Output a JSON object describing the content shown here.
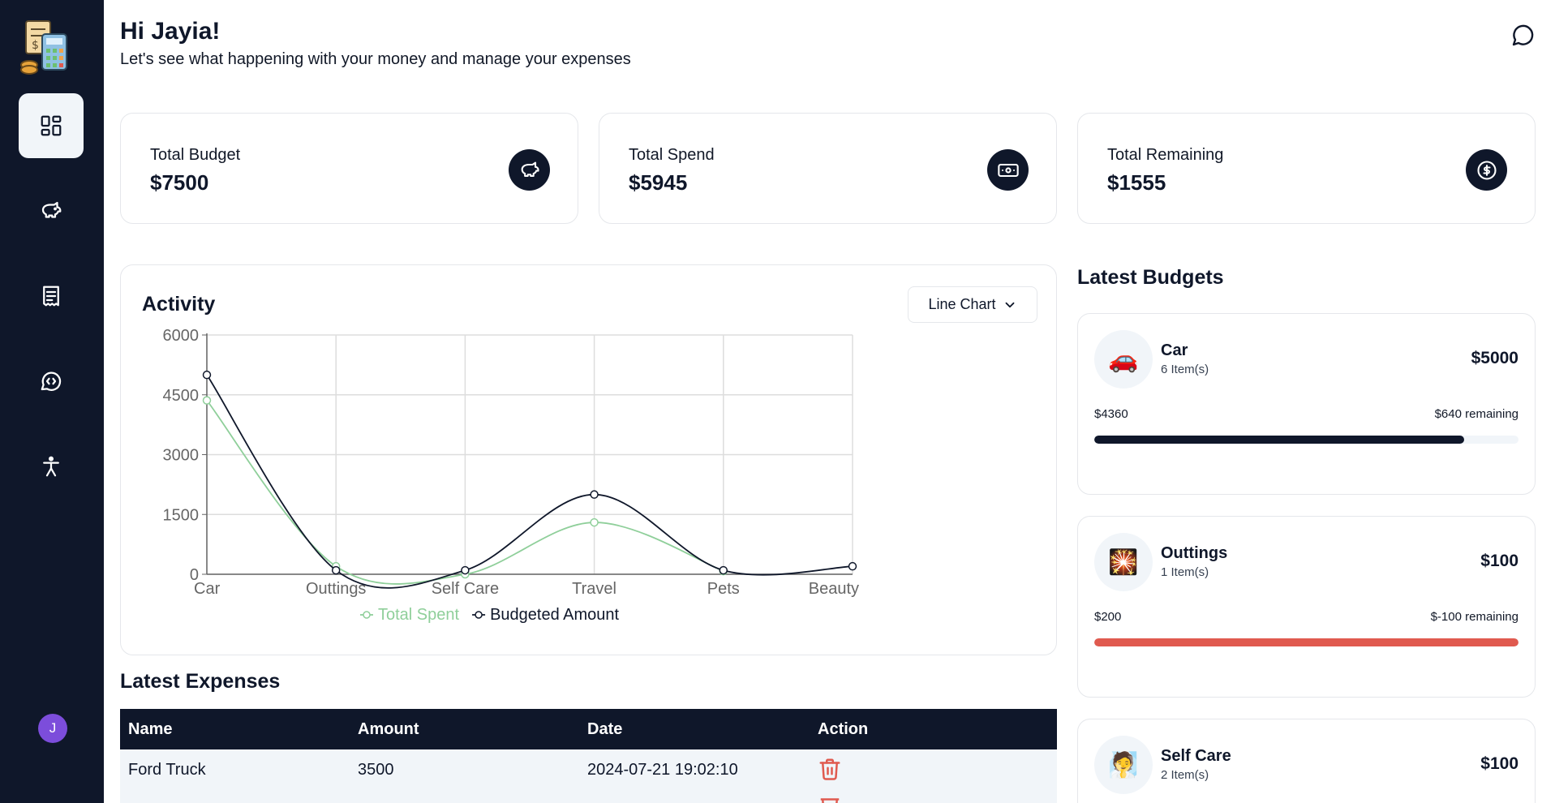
{
  "sidebar": {
    "logo_icon": "calculator-receipt-logo",
    "items": [
      {
        "name": "dashboard",
        "icon": "layout-dashboard-icon",
        "active": true
      },
      {
        "name": "budgets",
        "icon": "piggy-bank-icon",
        "active": false
      },
      {
        "name": "expenses",
        "icon": "receipt-icon",
        "active": false
      },
      {
        "name": "chat",
        "icon": "message-code-icon",
        "active": false
      },
      {
        "name": "accessibility",
        "icon": "accessibility-icon",
        "active": false
      }
    ],
    "avatar_initial": "J"
  },
  "header": {
    "greeting": "Hi Jayia!",
    "subtitle": "Let's see what happening with your money and manage your expenses",
    "chat_icon": "message-circle-icon"
  },
  "stats": [
    {
      "label": "Total Budget",
      "value": "$7500",
      "icon": "piggy-bank-icon"
    },
    {
      "label": "Total Spend",
      "value": "$5945",
      "icon": "banknote-icon"
    },
    {
      "label": "Total Remaining",
      "value": "$1555",
      "icon": "circle-dollar-icon"
    }
  ],
  "activity": {
    "title": "Activity",
    "chart_type_label": "Line Chart"
  },
  "chart_data": {
    "type": "line",
    "categories": [
      "Car",
      "Outtings",
      "Self Care",
      "Travel",
      "Pets",
      "Beauty"
    ],
    "series": [
      {
        "name": "Total Spent",
        "color": "#8fcf9a",
        "values": [
          4360,
          200,
          0,
          1300,
          80,
          null
        ]
      },
      {
        "name": "Budgeted Amount",
        "color": "#0f172a",
        "values": [
          5000,
          100,
          100,
          2000,
          100,
          200
        ]
      }
    ],
    "yticks": [
      0,
      1500,
      3000,
      4500,
      6000
    ],
    "ylim": [
      0,
      6000
    ],
    "grid": true,
    "legend": "bottom"
  },
  "latest_expenses": {
    "title": "Latest Expenses",
    "columns": [
      "Name",
      "Amount",
      "Date",
      "Action"
    ],
    "rows": [
      {
        "name": "Ford Truck",
        "amount": "3500",
        "date": "2024-07-21 19:02:10"
      }
    ]
  },
  "latest_budgets": {
    "title": "Latest Budgets",
    "items": [
      {
        "emoji": "🚗",
        "name": "Car",
        "items": "6 Item(s)",
        "amount": "$5000",
        "spent": "$4360",
        "remaining": "$640 remaining",
        "progress": 0.872,
        "bar_color": "#0f172a"
      },
      {
        "emoji": "🎇",
        "name": "Outtings",
        "items": "1 Item(s)",
        "amount": "$100",
        "spent": "$200",
        "remaining": "$-100 remaining",
        "progress": 1.0,
        "bar_color": "#e05a4f"
      },
      {
        "emoji": "🧖",
        "name": "Self Care",
        "items": "2 Item(s)",
        "amount": "$100"
      }
    ]
  }
}
